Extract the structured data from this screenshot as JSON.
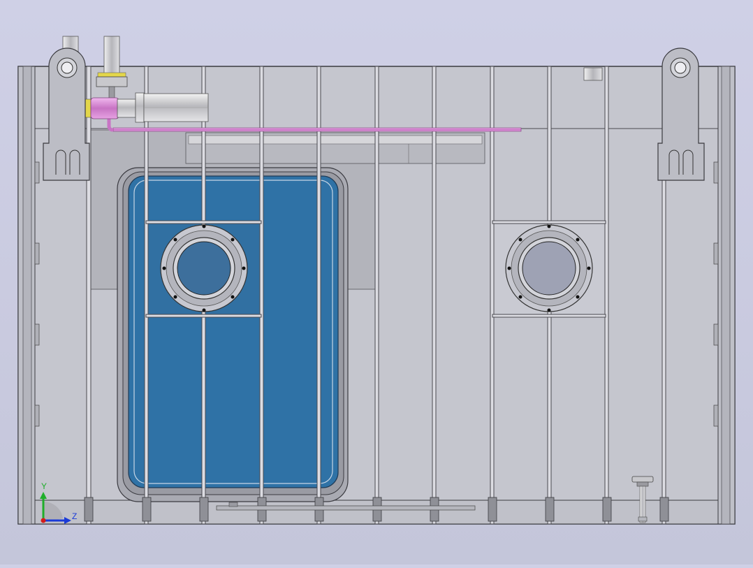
{
  "viewport": {
    "triad": {
      "y_label": "Y",
      "z_label": "Z"
    },
    "colors": {
      "background": "#cfd0e6",
      "panel": "#c6c7cf",
      "panel_dark": "#b3b4bb",
      "edge": "#3b3b40",
      "door": "#2f72a6",
      "door_window": "#3d6f9c",
      "porthole_glass": "#9ea2b4",
      "pipe_pink": "#d98ad7",
      "flange_yellow": "#e3d64a",
      "triad_y": "#1fae2a",
      "triad_z": "#1b3bd8",
      "triad_x": "#d41b1b"
    }
  }
}
